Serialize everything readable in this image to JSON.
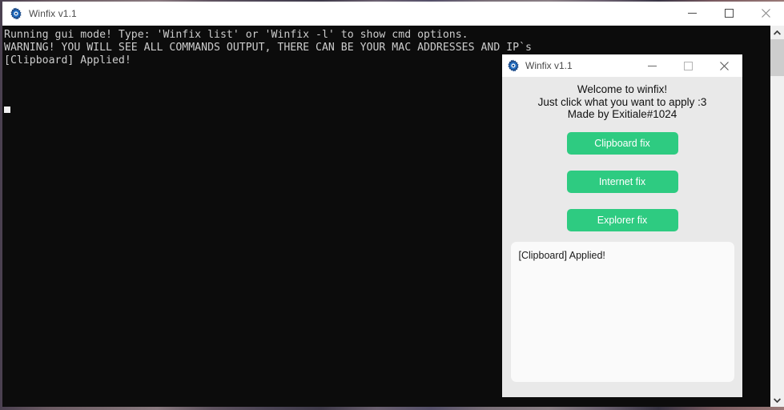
{
  "desktop": {
    "visible": "wallpaper-strip"
  },
  "console_window": {
    "title": "Winfix v1.1",
    "icon": "gear-icon",
    "controls": {
      "minimize": "minimize-icon",
      "maximize": "maximize-icon",
      "close": "close-icon"
    },
    "output_lines": [
      "Running gui mode! Type: 'Winfix list' or 'Winfix -l' to show cmd options.",
      "WARNING! YOU WILL SEE ALL COMMANDS OUTPUT, THERE CAN BE YOUR MAC ADDRESSES AND IP`s",
      "[Clipboard] Applied!"
    ],
    "output_text": "Running gui mode! Type: 'Winfix list' or 'Winfix -l' to show cmd options.\nWARNING! YOU WILL SEE ALL COMMANDS OUTPUT, THERE CAN BE YOUR MAC ADDRESSES AND IP`s\n[Clipboard] Applied!",
    "scrollbar": {
      "up_arrow": "chevron-up-icon",
      "down_arrow": "chevron-down-icon"
    }
  },
  "dialog": {
    "title": "Winfix v1.1",
    "icon": "gear-icon",
    "controls": {
      "minimize": "minimize-icon",
      "maximize": "maximize-icon",
      "close": "close-icon"
    },
    "welcome": {
      "line1": "Welcome to winfix!",
      "line2": "Just click what you want to apply :3",
      "line3": "Made by Exitiale#1024"
    },
    "buttons": [
      {
        "label": "Clipboard fix",
        "name": "clipboard-fix-button"
      },
      {
        "label": "Internet fix",
        "name": "internet-fix-button"
      },
      {
        "label": "Explorer fix",
        "name": "explorer-fix-button"
      }
    ],
    "log": {
      "text": "[Clipboard] Applied!"
    },
    "colors": {
      "button_green": "#2ecb81",
      "button_text": "#ffffff",
      "dialog_bg": "#e9e9e9",
      "log_bg": "#fafafa",
      "console_bg": "#0c0c0c",
      "console_text": "#cccccc"
    }
  }
}
